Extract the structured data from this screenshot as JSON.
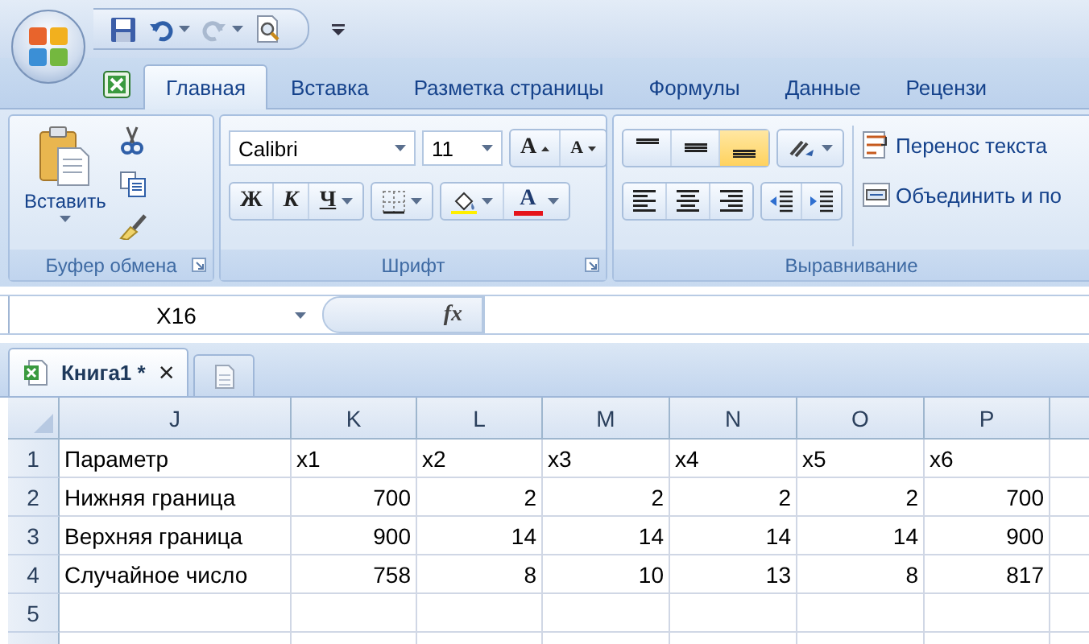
{
  "tabs": [
    {
      "label": "Главная",
      "selected": true
    },
    {
      "label": "Вставка",
      "selected": false
    },
    {
      "label": "Разметка страницы",
      "selected": false
    },
    {
      "label": "Формулы",
      "selected": false
    },
    {
      "label": "Данные",
      "selected": false
    },
    {
      "label": "Рецензи",
      "selected": false
    }
  ],
  "ribbon": {
    "clipboard": {
      "title": "Буфер обмена",
      "paste_label": "Вставить"
    },
    "font": {
      "title": "Шрифт",
      "font_name": "Calibri",
      "font_size": "11",
      "grow_label": "A",
      "shrink_label": "A",
      "bold": "Ж",
      "italic": "К",
      "underline": "Ч",
      "font_color_label": "A"
    },
    "alignment": {
      "title": "Выравнивание",
      "vertical": [
        {
          "selected": false
        },
        {
          "selected": false
        },
        {
          "selected": true
        }
      ],
      "horizontal": [
        {
          "selected": false
        },
        {
          "selected": false
        },
        {
          "selected": false
        }
      ],
      "wrap_text": "Перенос текста",
      "merge": "Объединить и по"
    }
  },
  "formula_bar": {
    "name_box": "X16",
    "function_button": "fx"
  },
  "workbook_tab": {
    "title": "Книга1 *",
    "close": "×"
  },
  "sheet": {
    "columns": [
      "J",
      "K",
      "L",
      "M",
      "N",
      "O",
      "P"
    ],
    "rows": [
      {
        "number": "1",
        "kind": "labels",
        "cells": [
          "Параметр",
          "x1",
          "x2",
          "x3",
          "x4",
          "x5",
          "x6"
        ]
      },
      {
        "number": "2",
        "kind": "values",
        "cells": [
          "Нижняя граница",
          "700",
          "2",
          "2",
          "2",
          "2",
          "700"
        ]
      },
      {
        "number": "3",
        "kind": "values",
        "cells": [
          "Верхняя граница",
          "900",
          "14",
          "14",
          "14",
          "14",
          "900"
        ]
      },
      {
        "number": "4",
        "kind": "values",
        "cells": [
          "Случайное число",
          "758",
          "8",
          "10",
          "13",
          "8",
          "817"
        ]
      },
      {
        "number": "5",
        "kind": "values",
        "cells": []
      }
    ]
  }
}
